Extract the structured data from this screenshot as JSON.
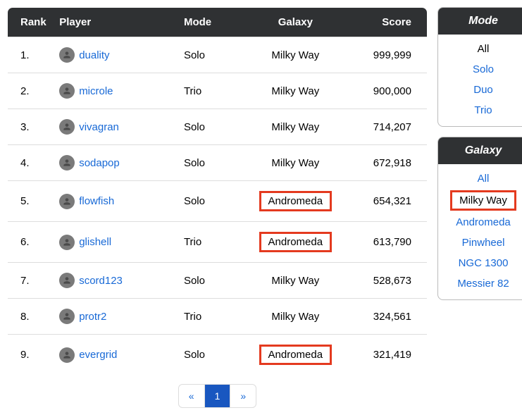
{
  "table": {
    "headers": {
      "rank": "Rank",
      "player": "Player",
      "mode": "Mode",
      "galaxy": "Galaxy",
      "score": "Score"
    },
    "rows": [
      {
        "rank": "1.",
        "player": "duality",
        "mode": "Solo",
        "galaxy": "Milky Way",
        "score": "999,999",
        "hl": false
      },
      {
        "rank": "2.",
        "player": "microle",
        "mode": "Trio",
        "galaxy": "Milky Way",
        "score": "900,000",
        "hl": false
      },
      {
        "rank": "3.",
        "player": "vivagran",
        "mode": "Solo",
        "galaxy": "Milky Way",
        "score": "714,207",
        "hl": false
      },
      {
        "rank": "4.",
        "player": "sodapop",
        "mode": "Solo",
        "galaxy": "Milky Way",
        "score": "672,918",
        "hl": false
      },
      {
        "rank": "5.",
        "player": "flowfish",
        "mode": "Solo",
        "galaxy": "Andromeda",
        "score": "654,321",
        "hl": true
      },
      {
        "rank": "6.",
        "player": "glishell",
        "mode": "Trio",
        "galaxy": "Andromeda",
        "score": "613,790",
        "hl": true
      },
      {
        "rank": "7.",
        "player": "scord123",
        "mode": "Solo",
        "galaxy": "Milky Way",
        "score": "528,673",
        "hl": false
      },
      {
        "rank": "8.",
        "player": "protr2",
        "mode": "Trio",
        "galaxy": "Milky Way",
        "score": "324,561",
        "hl": false
      },
      {
        "rank": "9.",
        "player": "evergrid",
        "mode": "Solo",
        "galaxy": "Andromeda",
        "score": "321,419",
        "hl": true
      }
    ]
  },
  "pagination": {
    "prev": "«",
    "page": "1",
    "next": "»"
  },
  "filters": {
    "mode": {
      "title": "Mode",
      "items": [
        {
          "label": "All",
          "selected": true,
          "boxed": false
        },
        {
          "label": "Solo",
          "selected": false,
          "boxed": false
        },
        {
          "label": "Duo",
          "selected": false,
          "boxed": false
        },
        {
          "label": "Trio",
          "selected": false,
          "boxed": false
        }
      ]
    },
    "galaxy": {
      "title": "Galaxy",
      "items": [
        {
          "label": "All",
          "selected": false,
          "boxed": false
        },
        {
          "label": "Milky Way",
          "selected": true,
          "boxed": true
        },
        {
          "label": "Andromeda",
          "selected": false,
          "boxed": false
        },
        {
          "label": "Pinwheel",
          "selected": false,
          "boxed": false
        },
        {
          "label": "NGC 1300",
          "selected": false,
          "boxed": false
        },
        {
          "label": "Messier 82",
          "selected": false,
          "boxed": false
        }
      ]
    }
  }
}
